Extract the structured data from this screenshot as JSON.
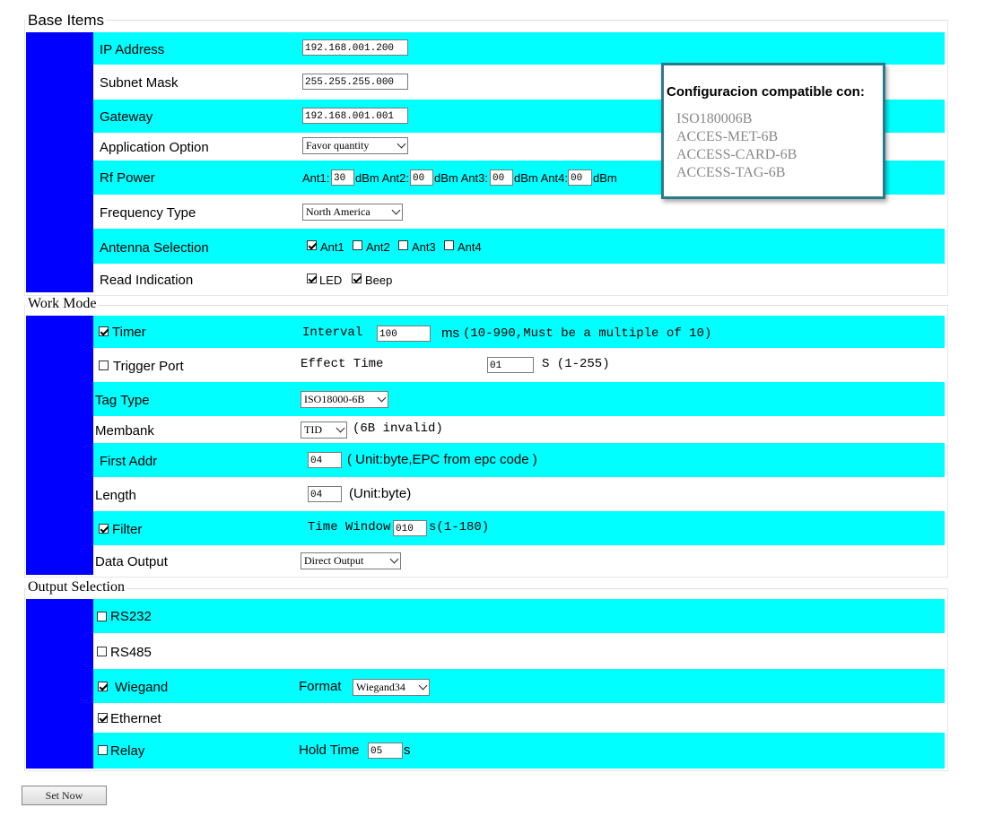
{
  "base_items": {
    "title": "Base Items",
    "ip_label": "IP Address",
    "ip_value": "192.168.001.200",
    "mask_label": "Subnet Mask",
    "mask_value": "255.255.255.000",
    "gateway_label": "Gateway",
    "gateway_value": "192.168.001.001",
    "app_option_label": "Application Option",
    "app_option_value": "Favor quantity",
    "rf_label": "Rf Power",
    "rf": {
      "ant1_label": "Ant1:",
      "ant1_value": "30",
      "ant2_label": "dBm Ant2:",
      "ant2_value": "00",
      "ant3_label": "dBm Ant3:",
      "ant3_value": "00",
      "ant4_label": "dBm Ant4:",
      "ant4_value": "00",
      "unit": "dBm"
    },
    "freq_label": "Frequency Type",
    "freq_value": "North America",
    "antenna_label": "Antenna Selection",
    "antennas": [
      {
        "label": "Ant1",
        "checked": true
      },
      {
        "label": "Ant2",
        "checked": false
      },
      {
        "label": "Ant3",
        "checked": false
      },
      {
        "label": "Ant4",
        "checked": false
      }
    ],
    "read_label": "Read Indication",
    "read_led": "LED",
    "read_beep": "Beep"
  },
  "popup": {
    "title": "Configuracion compatible con:",
    "items": [
      "ISO180006B",
      "ACCES-MET-6B",
      "ACCESS-CARD-6B",
      "ACCESS-TAG-6B"
    ]
  },
  "work_mode": {
    "title": "Work Mode",
    "timer_label": "Timer",
    "interval_label": "Interval",
    "interval_value": "100",
    "interval_hint_ms": "ms",
    "interval_hint": "(10-990,Must be a multiple of 10)",
    "trigger_label": "Trigger Port",
    "effect_label": "Effect Time",
    "effect_value": "01",
    "effect_hint": "S (1-255)",
    "tag_type_label": "Tag Type",
    "tag_type_value": "ISO18000-6B",
    "membank_label": "Membank",
    "membank_value": "TID",
    "membank_hint": "(6B invalid)",
    "first_addr_label": "First Addr",
    "first_addr_value": "04",
    "first_addr_hint": "( Unit:byte,EPC from epc code )",
    "length_label": "Length",
    "length_value": "04",
    "length_hint": "(Unit:byte)",
    "filter_label": "Filter",
    "time_window_label": "Time Window",
    "time_window_value": "010",
    "time_window_hint": "s(1-180)",
    "data_output_label": "Data Output",
    "data_output_value": "Direct Output"
  },
  "output_selection": {
    "title": "Output Selection",
    "rs232": "RS232",
    "rs485": "RS485",
    "wiegand": "Wiegand",
    "format_label": "Format",
    "format_value": "Wiegand34",
    "ethernet": "Ethernet",
    "relay": "Relay",
    "hold_label": "Hold Time",
    "hold_value": "05",
    "hold_unit": "s"
  },
  "set_now_label": "Set Now",
  "colors": {
    "row_cyan": "#00ffff",
    "bar_blue": "#0000ff",
    "popup_border": "#2b7a8c"
  }
}
